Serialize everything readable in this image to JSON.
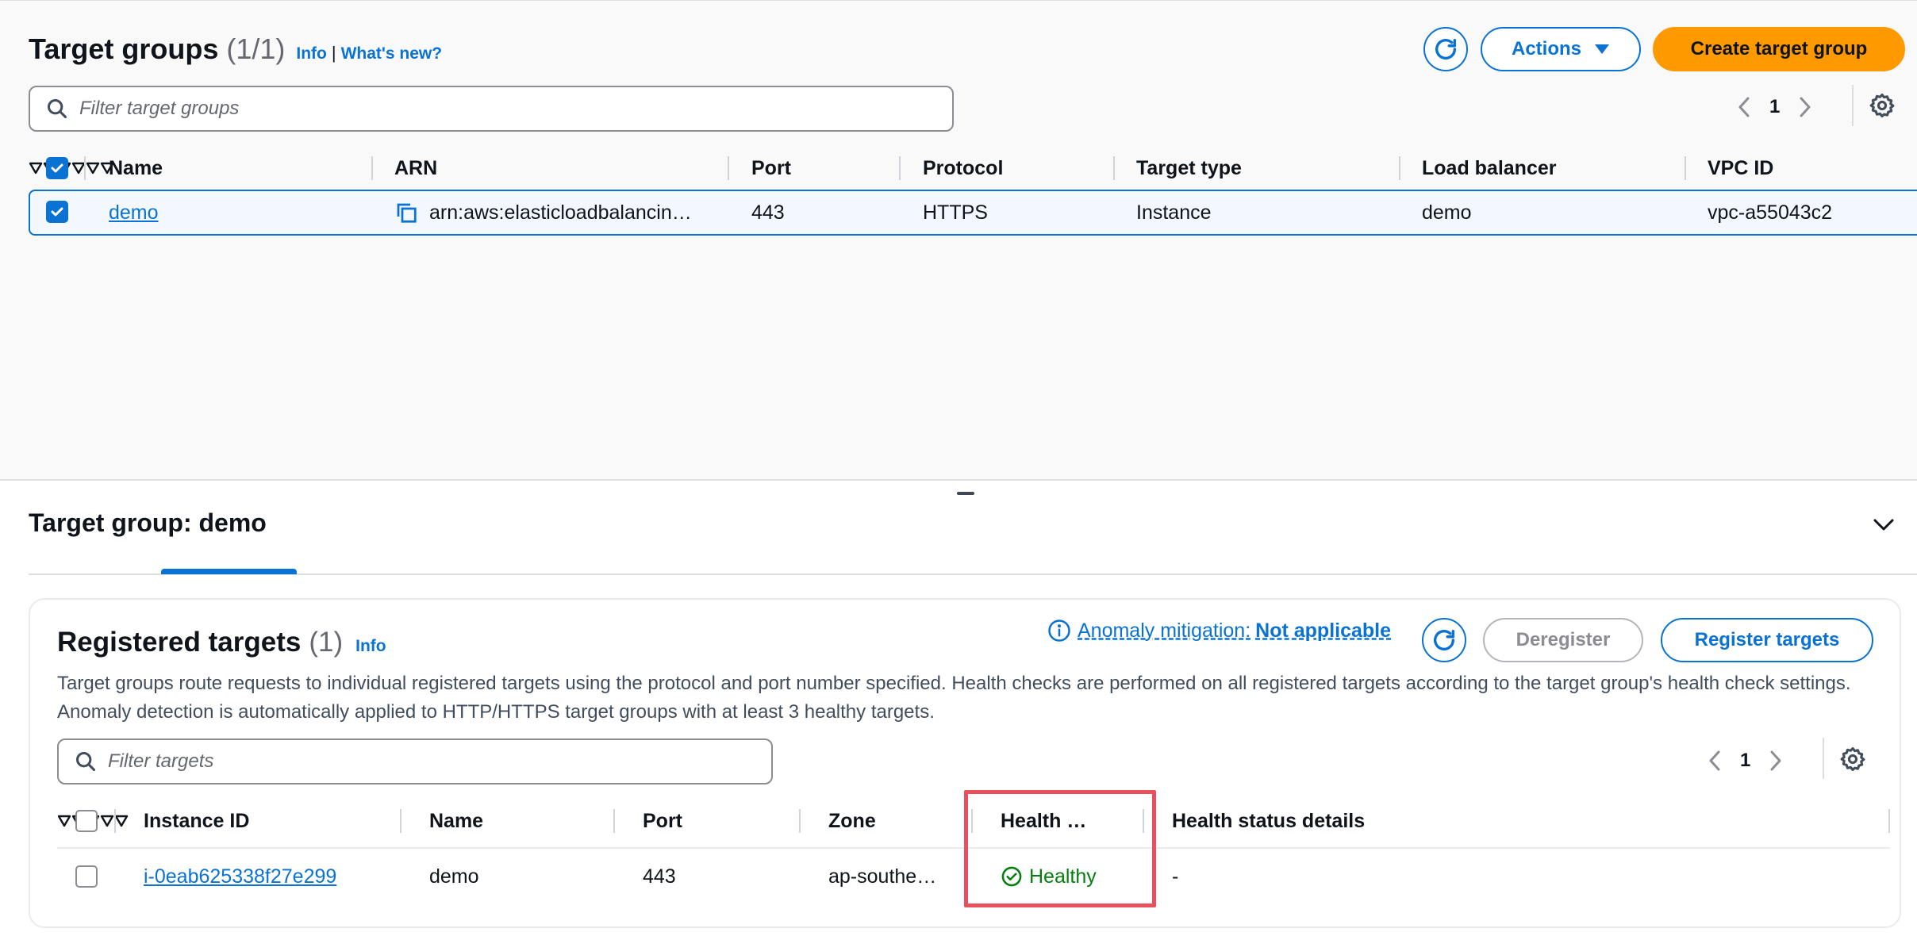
{
  "target_groups": {
    "title": "Target groups",
    "count": "(1/1)",
    "info_link": "Info",
    "separator": "|",
    "whats_new_link": "What's new?",
    "actions_label": "Actions",
    "create_label": "Create target group",
    "search_placeholder": "Filter target groups",
    "page_number": "1",
    "columns": [
      "Name",
      "ARN",
      "Port",
      "Protocol",
      "Target type",
      "Load balancer",
      "VPC ID"
    ],
    "rows": [
      {
        "selected": true,
        "name": "demo",
        "arn": "arn:aws:elasticloadbalancin…",
        "port": "443",
        "protocol": "HTTPS",
        "target_type": "Instance",
        "load_balancer": "demo",
        "vpc_id": "vpc-a55043c2"
      }
    ]
  },
  "detail": {
    "title": "Target group: demo"
  },
  "registered_targets": {
    "title": "Registered targets",
    "count": "(1)",
    "info_link": "Info",
    "anomaly_label": "Anomaly mitigation:",
    "anomaly_value": "Not applicable",
    "deregister_label": "Deregister",
    "register_label": "Register targets",
    "description": "Target groups route requests to individual registered targets using the protocol and port number specified. Health checks are performed on all registered targets according to the target group's health check settings. Anomaly detection is automatically applied to HTTP/HTTPS target groups with at least 3 healthy targets.",
    "search_placeholder": "Filter targets",
    "page_number": "1",
    "columns": [
      "Instance ID",
      "Name",
      "Port",
      "Zone",
      "Health …",
      "Health status details"
    ],
    "rows": [
      {
        "instance_id": "i-0eab625338f27e299",
        "name": "demo",
        "port": "443",
        "zone": "ap-southe…",
        "health": "Healthy",
        "health_details": "-"
      }
    ]
  },
  "colors": {
    "accent": "#0972d3",
    "primary_button": "#ff9900",
    "healthy": "#037f0c",
    "highlight": "#e8505b"
  }
}
